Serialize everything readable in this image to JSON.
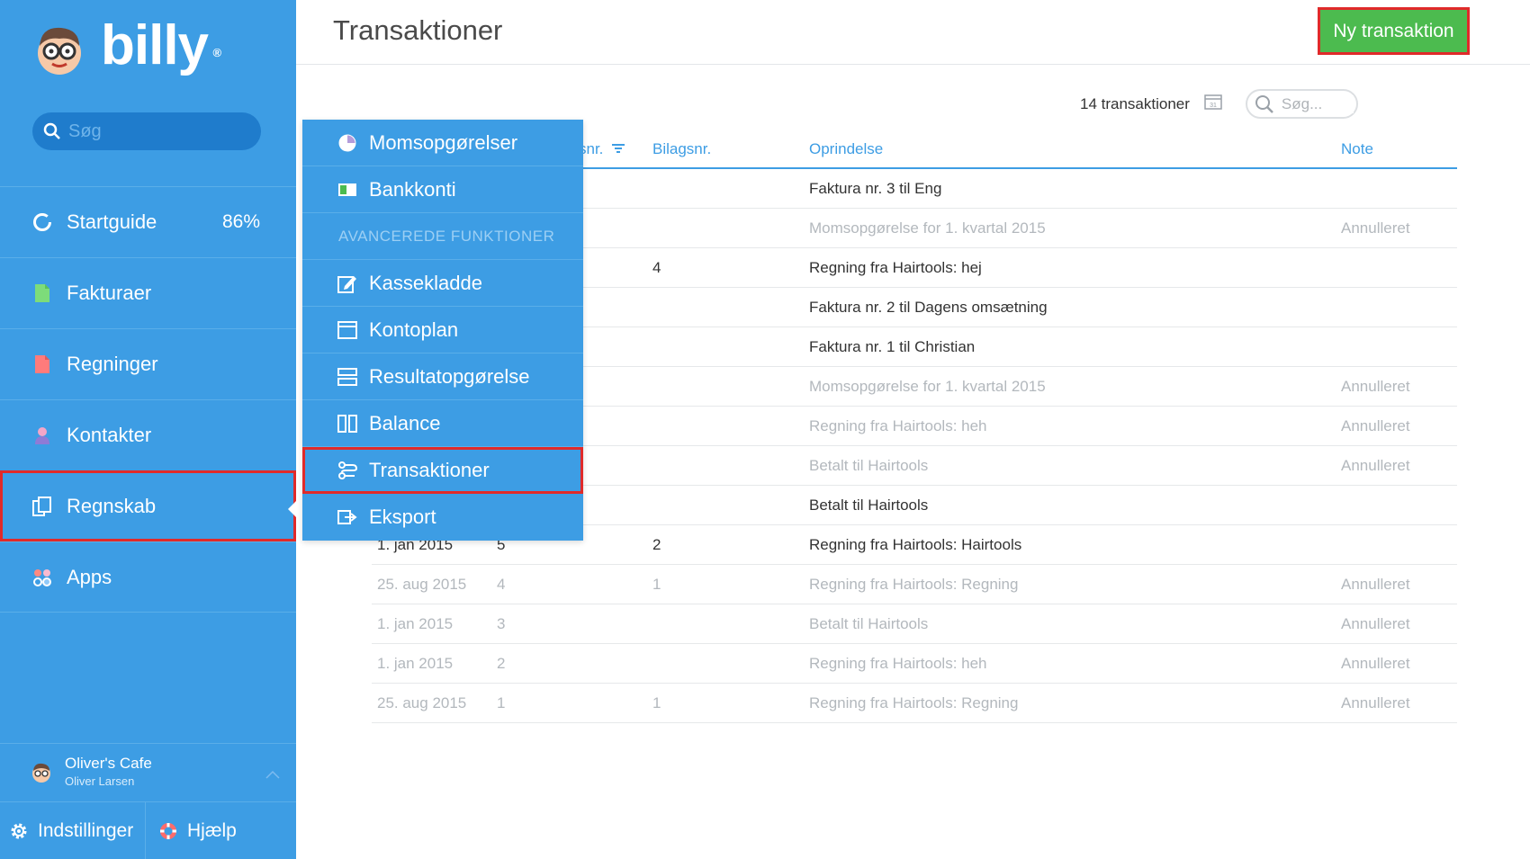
{
  "app": {
    "brand": "billy",
    "brand_mark": "®"
  },
  "sidebar": {
    "search_placeholder": "Søg",
    "items": [
      {
        "label": "Startguide",
        "icon": "progress-circle-icon",
        "value": "86%"
      },
      {
        "label": "Fakturaer",
        "icon": "invoice-icon"
      },
      {
        "label": "Regninger",
        "icon": "bill-icon"
      },
      {
        "label": "Kontakter",
        "icon": "contact-icon"
      },
      {
        "label": "Regnskab",
        "icon": "accounting-icon",
        "active": true
      },
      {
        "label": "Apps",
        "icon": "apps-icon"
      }
    ],
    "org_name": "Oliver's Cafe",
    "org_user": "Oliver Larsen",
    "settings_label": "Indstillinger",
    "help_label": "Hjælp"
  },
  "header": {
    "title": "Transaktioner",
    "new_button": "Ny transaktion"
  },
  "toolbar": {
    "count": "14 transaktioner",
    "calendar_day": "31",
    "search_placeholder": "Søg..."
  },
  "table": {
    "columns": {
      "num_partial": "snr.",
      "bilag": "Bilagsnr.",
      "origin": "Oprindelse",
      "note": "Note"
    },
    "rows": [
      {
        "date": "",
        "num": "",
        "bilag": "",
        "origin": "Faktura nr. 3 til Eng",
        "note": "",
        "muted": false
      },
      {
        "date": "",
        "num": "",
        "bilag": "",
        "origin": "Momsopgørelse for 1. kvartal 2015",
        "note": "Annulleret",
        "muted": true
      },
      {
        "date": "",
        "num": "",
        "bilag": "4",
        "origin": "Regning fra Hairtools: hej",
        "note": "",
        "muted": false
      },
      {
        "date": "",
        "num": "",
        "bilag": "",
        "origin": "Faktura nr. 2 til Dagens omsætning",
        "note": "",
        "muted": false
      },
      {
        "date": "",
        "num": "",
        "bilag": "",
        "origin": "Faktura nr. 1 til Christian",
        "note": "",
        "muted": false
      },
      {
        "date": "",
        "num": "",
        "bilag": "",
        "origin": "Momsopgørelse for 1. kvartal 2015",
        "note": "Annulleret",
        "muted": true
      },
      {
        "date": "",
        "num": "",
        "bilag": "",
        "origin": "Regning fra Hairtools: heh",
        "note": "Annulleret",
        "muted": true
      },
      {
        "date": "",
        "num": "",
        "bilag": "",
        "origin": "Betalt til Hairtools",
        "note": "Annulleret",
        "muted": true
      },
      {
        "date": "",
        "num": "",
        "bilag": "",
        "origin": "Betalt til Hairtools",
        "note": "",
        "muted": false
      },
      {
        "date": "1. jan 2015",
        "num": "5",
        "bilag": "2",
        "origin": "Regning fra Hairtools: Hairtools",
        "note": "",
        "muted": false
      },
      {
        "date": "25. aug 2015",
        "num": "4",
        "bilag": "1",
        "origin": "Regning fra Hairtools: Regning",
        "note": "Annulleret",
        "muted": true
      },
      {
        "date": "1. jan 2015",
        "num": "3",
        "bilag": "",
        "origin": "Betalt til Hairtools",
        "note": "Annulleret",
        "muted": true
      },
      {
        "date": "1. jan 2015",
        "num": "2",
        "bilag": "",
        "origin": "Regning fra Hairtools: heh",
        "note": "Annulleret",
        "muted": true
      },
      {
        "date": "25. aug 2015",
        "num": "1",
        "bilag": "1",
        "origin": "Regning fra Hairtools: Regning",
        "note": "Annulleret",
        "muted": true
      }
    ]
  },
  "dropdown": {
    "items": [
      {
        "type": "item",
        "label": "Momsopgørelser",
        "icon": "pie-chart-icon"
      },
      {
        "type": "item",
        "label": "Bankkonti",
        "icon": "bank-icon"
      },
      {
        "type": "section",
        "label": "AVANCEREDE FUNKTIONER"
      },
      {
        "type": "item",
        "label": "Kassekladde",
        "icon": "edit-icon"
      },
      {
        "type": "item",
        "label": "Kontoplan",
        "icon": "chart-of-accounts-icon"
      },
      {
        "type": "item",
        "label": "Resultatopgørelse",
        "icon": "income-statement-icon"
      },
      {
        "type": "item",
        "label": "Balance",
        "icon": "balance-icon"
      },
      {
        "type": "item",
        "label": "Transaktioner",
        "icon": "transactions-icon",
        "active": true
      },
      {
        "type": "item",
        "label": "Eksport",
        "icon": "export-icon"
      }
    ]
  },
  "colors": {
    "sidebar": "#3d9de4",
    "accent": "#3d9de4",
    "new_button": "#4cbb4f",
    "highlight": "#e02a2a"
  }
}
